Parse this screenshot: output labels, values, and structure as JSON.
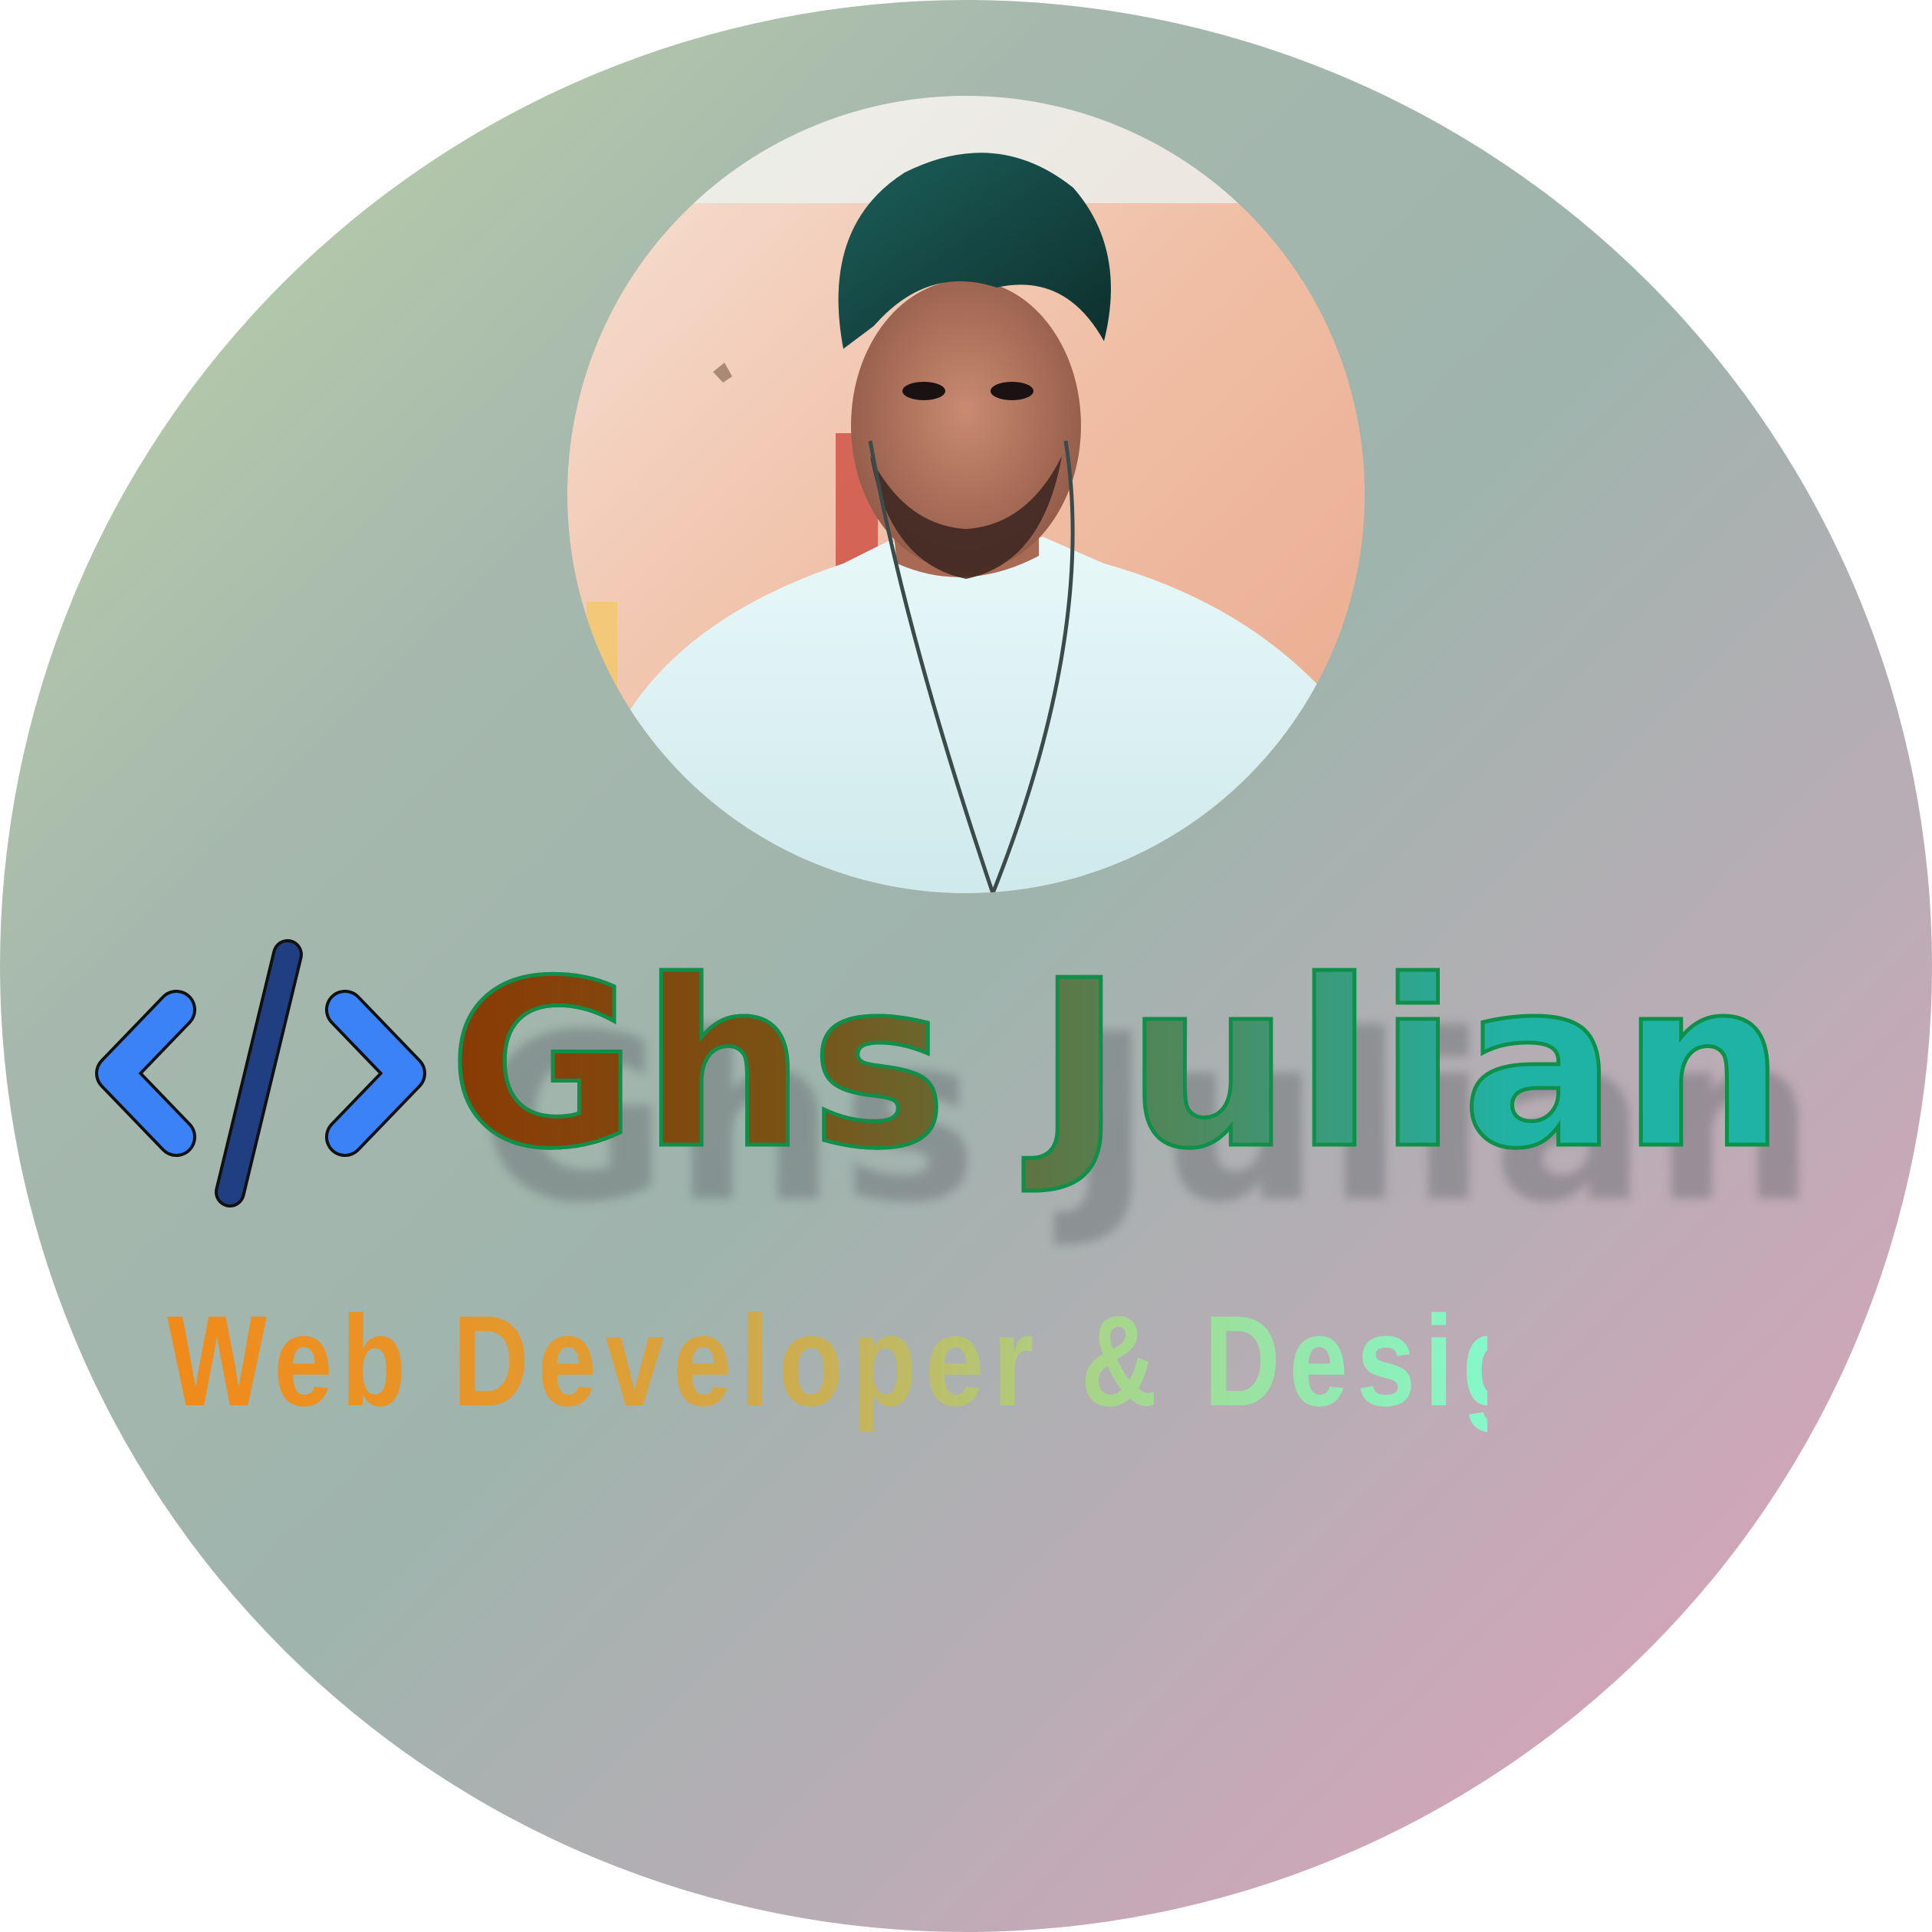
{
  "profile": {
    "photo_icon": "person-portrait",
    "code_icon": "code-brackets-icon",
    "name": "Ghs Julian",
    "tagline": "Web Developer & Designer"
  },
  "colors": {
    "background_start": "#bfd6a8",
    "background_mid": "#9fb4ad",
    "background_end": "#e6a0ba",
    "bracket_blue": "#3b82f6",
    "slash_navy": "#1f3f82",
    "name_start": "#8a3a04",
    "name_end": "#1fb3a6",
    "name_outline": "#0e8f4a",
    "tagline_start": "#f08a1a",
    "tagline_end": "#85f8c9"
  }
}
